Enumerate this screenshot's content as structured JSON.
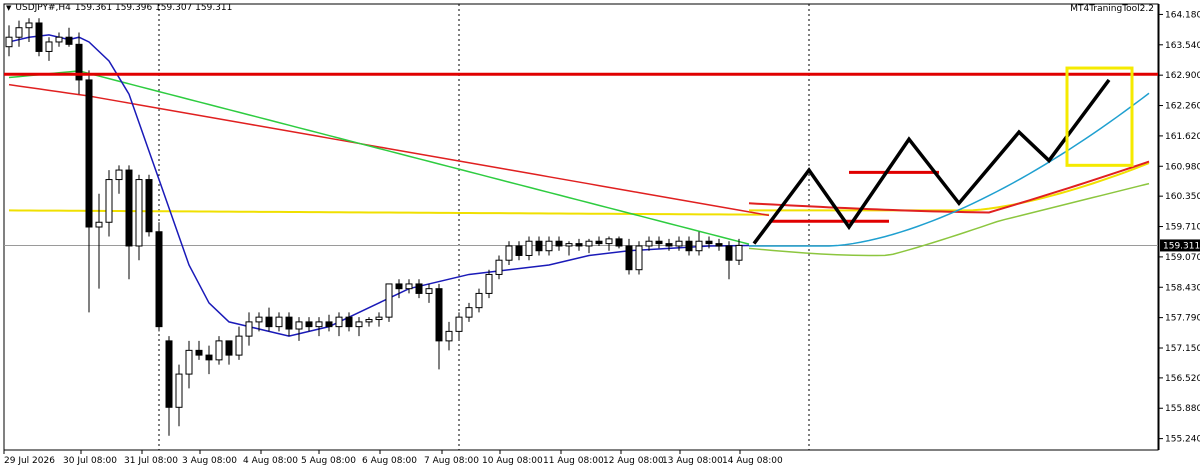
{
  "header": {
    "symbol": "USDJPY#,H4",
    "ohlc": "159.361 159.396 159.307 159.311",
    "indicator": "MT4TraningTool2.2",
    "menu_icon": "triangle-down-icon"
  },
  "colors": {
    "bull_fill": "#ffffff",
    "candle_stroke": "#000000",
    "bear_fill": "#000000",
    "ma_fast": "#1a1ab8",
    "ma_mid": "#2ecc40",
    "ma_slow": "#e02020",
    "ma_long": "#f0e000",
    "resistance": "#e00000",
    "projection": "#000000",
    "proj_fast": "#1fa0d0",
    "proj_mid": "#8cc63f",
    "target_box": "#f5ea00",
    "current_price_label_bg": "#000000"
  },
  "chart_data": {
    "type": "candlestick",
    "y_ticks": [
      "164.180",
      "163.540",
      "162.900",
      "162.260",
      "161.620",
      "160.980",
      "160.350",
      "159.710",
      "159.070",
      "158.430",
      "157.790",
      "157.150",
      "156.520",
      "155.880",
      "155.240"
    ],
    "x_labels": [
      "29 Jul 2026",
      "30 Jul 08:00",
      "31 Jul 08:00",
      "3 Aug 08:00",
      "4 Aug 08:00",
      "5 Aug 08:00",
      "6 Aug 08:00",
      "7 Aug 08:00",
      "10 Aug 08:00",
      "11 Aug 08:00",
      "12 Aug 08:00",
      "13 Aug 08:00",
      "14 Aug 08:00"
    ],
    "ylim": [
      155.0,
      164.4
    ],
    "current_price": "159.311",
    "current_price_value": 159.311,
    "resistance_level": 162.92,
    "support_marks": [
      {
        "from": 76,
        "to": 88,
        "price": 159.82
      },
      {
        "from": 84,
        "to": 93,
        "price": 160.85
      }
    ],
    "session_separators": [
      15,
      45,
      80
    ],
    "candles": [
      {
        "o": 163.5,
        "h": 163.95,
        "l": 163.3,
        "c": 163.7
      },
      {
        "o": 163.7,
        "h": 164.05,
        "l": 163.5,
        "c": 163.9
      },
      {
        "o": 163.9,
        "h": 164.1,
        "l": 163.6,
        "c": 164.0
      },
      {
        "o": 164.0,
        "h": 164.1,
        "l": 163.3,
        "c": 163.4
      },
      {
        "o": 163.4,
        "h": 163.7,
        "l": 163.2,
        "c": 163.6
      },
      {
        "o": 163.6,
        "h": 163.8,
        "l": 163.5,
        "c": 163.7
      },
      {
        "o": 163.7,
        "h": 163.9,
        "l": 163.5,
        "c": 163.55
      },
      {
        "o": 163.55,
        "h": 163.8,
        "l": 162.5,
        "c": 162.8
      },
      {
        "o": 162.8,
        "h": 163.0,
        "l": 157.9,
        "c": 159.7
      },
      {
        "o": 159.7,
        "h": 160.4,
        "l": 158.4,
        "c": 159.8
      },
      {
        "o": 159.8,
        "h": 160.9,
        "l": 159.5,
        "c": 160.7
      },
      {
        "o": 160.7,
        "h": 161.0,
        "l": 160.4,
        "c": 160.9
      },
      {
        "o": 160.9,
        "h": 161.0,
        "l": 158.6,
        "c": 159.3
      },
      {
        "o": 159.3,
        "h": 160.8,
        "l": 159.0,
        "c": 160.7
      },
      {
        "o": 160.7,
        "h": 160.8,
        "l": 159.5,
        "c": 159.6
      },
      {
        "o": 159.6,
        "h": 159.8,
        "l": 157.5,
        "c": 157.6
      },
      {
        "o": 157.3,
        "h": 157.4,
        "l": 155.3,
        "c": 155.9
      },
      {
        "o": 155.9,
        "h": 156.8,
        "l": 155.5,
        "c": 156.6
      },
      {
        "o": 156.6,
        "h": 157.3,
        "l": 156.3,
        "c": 157.1
      },
      {
        "o": 157.1,
        "h": 157.3,
        "l": 156.9,
        "c": 157.0
      },
      {
        "o": 157.0,
        "h": 157.2,
        "l": 156.6,
        "c": 156.9
      },
      {
        "o": 156.9,
        "h": 157.4,
        "l": 156.8,
        "c": 157.3
      },
      {
        "o": 157.3,
        "h": 157.3,
        "l": 156.8,
        "c": 157.0
      },
      {
        "o": 157.0,
        "h": 157.6,
        "l": 156.9,
        "c": 157.4
      },
      {
        "o": 157.4,
        "h": 157.9,
        "l": 157.2,
        "c": 157.7
      },
      {
        "o": 157.7,
        "h": 157.9,
        "l": 157.5,
        "c": 157.8
      },
      {
        "o": 157.8,
        "h": 158.0,
        "l": 157.5,
        "c": 157.6
      },
      {
        "o": 157.6,
        "h": 157.9,
        "l": 157.5,
        "c": 157.8
      },
      {
        "o": 157.8,
        "h": 157.9,
        "l": 157.4,
        "c": 157.55
      },
      {
        "o": 157.55,
        "h": 157.8,
        "l": 157.3,
        "c": 157.7
      },
      {
        "o": 157.7,
        "h": 157.8,
        "l": 157.5,
        "c": 157.6
      },
      {
        "o": 157.6,
        "h": 157.8,
        "l": 157.4,
        "c": 157.7
      },
      {
        "o": 157.7,
        "h": 157.85,
        "l": 157.5,
        "c": 157.6
      },
      {
        "o": 157.6,
        "h": 157.9,
        "l": 157.4,
        "c": 157.8
      },
      {
        "o": 157.8,
        "h": 157.9,
        "l": 157.5,
        "c": 157.6
      },
      {
        "o": 157.6,
        "h": 157.8,
        "l": 157.4,
        "c": 157.7
      },
      {
        "o": 157.7,
        "h": 157.8,
        "l": 157.6,
        "c": 157.75
      },
      {
        "o": 157.75,
        "h": 157.9,
        "l": 157.6,
        "c": 157.8
      },
      {
        "o": 157.8,
        "h": 158.5,
        "l": 157.7,
        "c": 158.5
      },
      {
        "o": 158.5,
        "h": 158.6,
        "l": 158.2,
        "c": 158.4
      },
      {
        "o": 158.4,
        "h": 158.6,
        "l": 158.3,
        "c": 158.5
      },
      {
        "o": 158.5,
        "h": 158.6,
        "l": 158.2,
        "c": 158.3
      },
      {
        "o": 158.3,
        "h": 158.5,
        "l": 158.1,
        "c": 158.4
      },
      {
        "o": 158.4,
        "h": 158.5,
        "l": 156.7,
        "c": 157.3
      },
      {
        "o": 157.3,
        "h": 157.7,
        "l": 157.1,
        "c": 157.5
      },
      {
        "o": 157.5,
        "h": 157.9,
        "l": 157.3,
        "c": 157.8
      },
      {
        "o": 157.8,
        "h": 158.1,
        "l": 157.7,
        "c": 158.0
      },
      {
        "o": 158.0,
        "h": 158.4,
        "l": 157.9,
        "c": 158.3
      },
      {
        "o": 158.3,
        "h": 158.8,
        "l": 158.2,
        "c": 158.7
      },
      {
        "o": 158.7,
        "h": 159.1,
        "l": 158.6,
        "c": 159.0
      },
      {
        "o": 159.0,
        "h": 159.4,
        "l": 158.9,
        "c": 159.3
      },
      {
        "o": 159.3,
        "h": 159.4,
        "l": 159.0,
        "c": 159.1
      },
      {
        "o": 159.1,
        "h": 159.5,
        "l": 159.0,
        "c": 159.4
      },
      {
        "o": 159.4,
        "h": 159.5,
        "l": 159.1,
        "c": 159.2
      },
      {
        "o": 159.2,
        "h": 159.5,
        "l": 159.1,
        "c": 159.4
      },
      {
        "o": 159.4,
        "h": 159.5,
        "l": 159.2,
        "c": 159.3
      },
      {
        "o": 159.3,
        "h": 159.4,
        "l": 159.1,
        "c": 159.35
      },
      {
        "o": 159.35,
        "h": 159.45,
        "l": 159.2,
        "c": 159.3
      },
      {
        "o": 159.3,
        "h": 159.45,
        "l": 159.15,
        "c": 159.4
      },
      {
        "o": 159.4,
        "h": 159.5,
        "l": 159.3,
        "c": 159.35
      },
      {
        "o": 159.35,
        "h": 159.5,
        "l": 159.2,
        "c": 159.45
      },
      {
        "o": 159.45,
        "h": 159.5,
        "l": 159.25,
        "c": 159.3
      },
      {
        "o": 159.3,
        "h": 159.45,
        "l": 158.7,
        "c": 158.8
      },
      {
        "o": 158.8,
        "h": 159.4,
        "l": 158.7,
        "c": 159.3
      },
      {
        "o": 159.3,
        "h": 159.5,
        "l": 159.2,
        "c": 159.4
      },
      {
        "o": 159.4,
        "h": 159.5,
        "l": 159.25,
        "c": 159.35
      },
      {
        "o": 159.35,
        "h": 159.45,
        "l": 159.2,
        "c": 159.3
      },
      {
        "o": 159.3,
        "h": 159.5,
        "l": 159.2,
        "c": 159.4
      },
      {
        "o": 159.4,
        "h": 159.5,
        "l": 159.1,
        "c": 159.2
      },
      {
        "o": 159.2,
        "h": 159.6,
        "l": 159.1,
        "c": 159.4
      },
      {
        "o": 159.4,
        "h": 159.5,
        "l": 159.25,
        "c": 159.35
      },
      {
        "o": 159.35,
        "h": 159.45,
        "l": 159.2,
        "c": 159.3
      },
      {
        "o": 159.3,
        "h": 159.4,
        "l": 158.6,
        "c": 159.0
      },
      {
        "o": 159.0,
        "h": 159.45,
        "l": 158.9,
        "c": 159.311
      }
    ],
    "series": [
      {
        "values": [
          163.6,
          163.7,
          163.75,
          163.7,
          163.65,
          163.7,
          163.6,
          163.2,
          162.5,
          161.9,
          161.3,
          160.7,
          160.1,
          159.5,
          158.9,
          158.5,
          158.1,
          157.9,
          157.7,
          157.65,
          157.6,
          157.55,
          157.5,
          157.45,
          157.4,
          157.45,
          157.5,
          157.55,
          157.6,
          157.7,
          157.8,
          157.9,
          158.0,
          158.1,
          158.2,
          158.3,
          158.4,
          158.5,
          158.6,
          158.7,
          158.75,
          158.8,
          158.85,
          158.9,
          159.0,
          159.1,
          159.2,
          159.25,
          159.3,
          159.31
        ],
        "at": [
          0,
          2,
          4,
          5,
          6,
          7,
          8,
          10,
          12,
          13,
          14,
          15,
          16,
          17,
          18,
          19,
          20,
          21,
          22,
          23,
          24,
          25,
          26,
          27,
          28,
          29,
          30,
          31,
          32,
          33,
          34,
          35,
          36,
          37,
          38,
          39,
          40,
          42,
          44,
          46,
          48,
          50,
          52,
          54,
          56,
          58,
          62,
          66,
          70,
          74
        ]
      }
    ]
  },
  "projection": {
    "zigzag": [
      [
        74.5,
        159.35
      ],
      [
        80,
        160.9
      ],
      [
        84,
        159.7
      ],
      [
        90,
        161.55
      ],
      [
        95,
        160.2
      ],
      [
        101,
        161.7
      ],
      [
        104,
        161.1
      ],
      [
        110,
        162.8
      ]
    ]
  }
}
